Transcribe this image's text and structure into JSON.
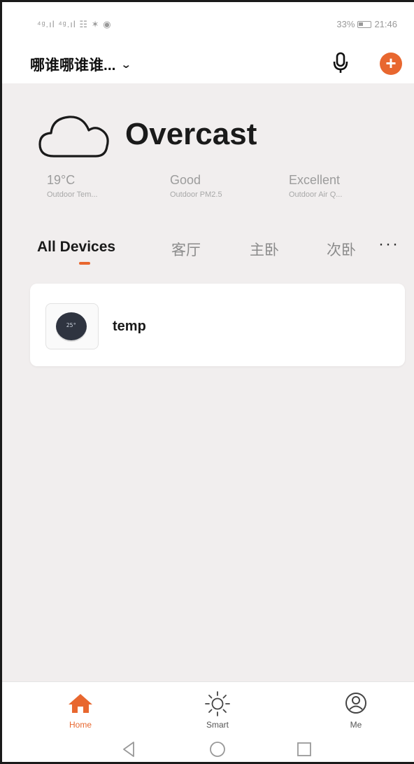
{
  "status_bar": {
    "left": "⁴ᵍ.ıl ⁴ᵍ.ıl ☷ ✶ ◉",
    "battery_text": "33%",
    "time": "21:46"
  },
  "header": {
    "home_name": "哪谁哪谁谁...",
    "accent_color": "#e8672f"
  },
  "weather": {
    "condition": "Overcast",
    "metrics": [
      {
        "value": "19°C",
        "label": "Outdoor Tem..."
      },
      {
        "value": "Good",
        "label": "Outdoor PM2.5"
      },
      {
        "value": "Excellent",
        "label": "Outdoor Air Q..."
      }
    ]
  },
  "tabs": [
    {
      "label": "All Devices",
      "active": true
    },
    {
      "label": "客厅",
      "active": false
    },
    {
      "label": "主卧",
      "active": false
    },
    {
      "label": "次卧",
      "active": false
    }
  ],
  "more_tabs": "···",
  "devices": [
    {
      "name": "temp",
      "dial_text": "25°"
    }
  ],
  "bottom_nav": [
    {
      "label": "Home",
      "icon": "home-icon",
      "active": true
    },
    {
      "label": "Smart",
      "icon": "sun-icon",
      "active": false
    },
    {
      "label": "Me",
      "icon": "profile-icon",
      "active": false
    }
  ]
}
